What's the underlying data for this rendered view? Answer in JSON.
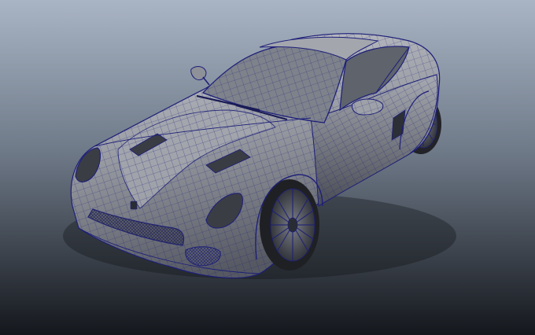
{
  "scene": {
    "subject": "sports-car-wireframe-model",
    "render_mode": "wireframe-on-shaded",
    "colors": {
      "bg_top": "#a9b4c4",
      "bg_bottom": "#14171c",
      "body": "#8b8e95",
      "body_light": "#c2c5cb",
      "body_dark": "#4b4e56",
      "wire": "#1d1f78",
      "tire": "#232428",
      "glass": "#6e727a"
    }
  }
}
